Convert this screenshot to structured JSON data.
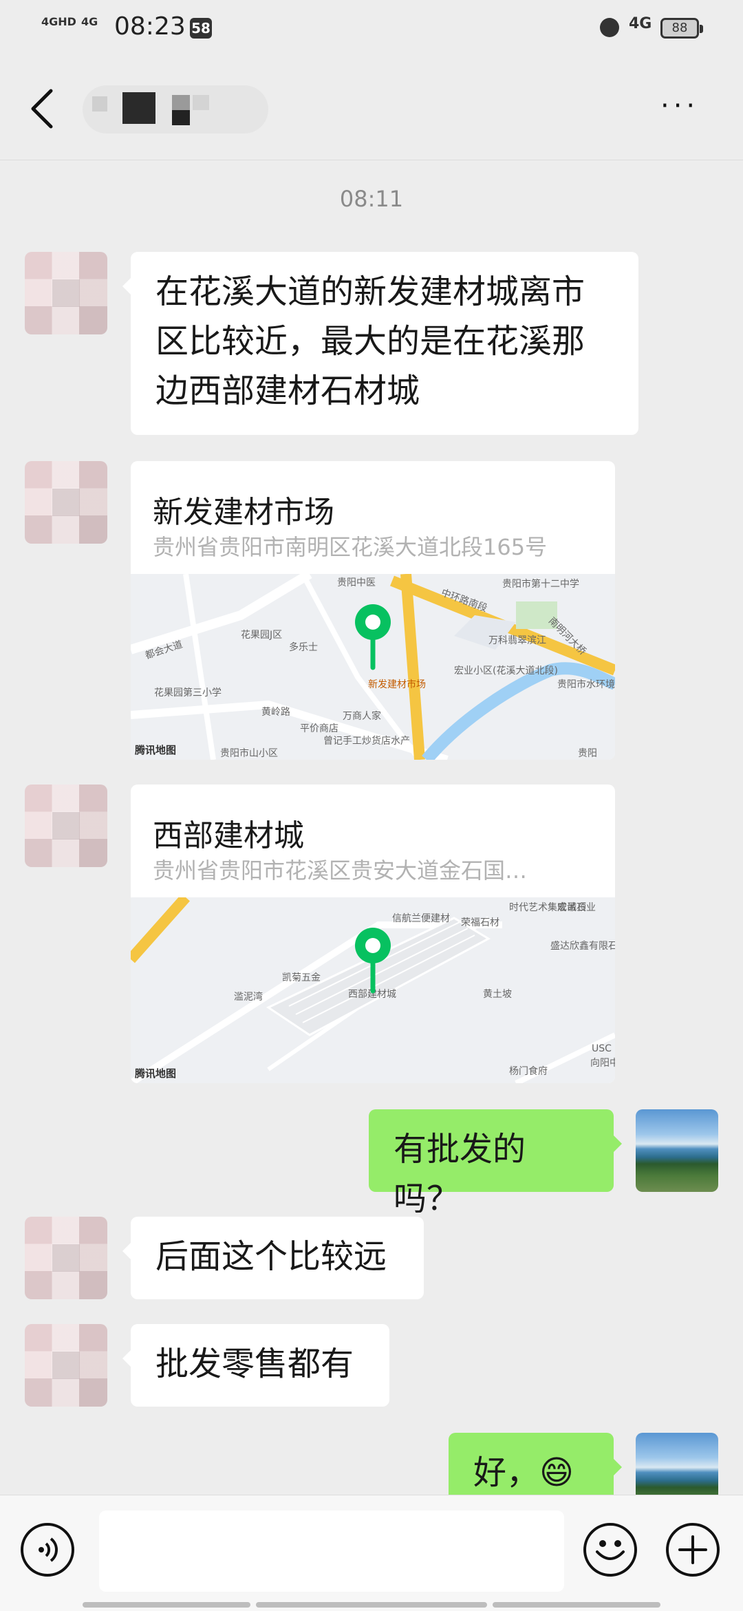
{
  "status_bar": {
    "network1": "4GHD",
    "network2": "4G",
    "time": "08:23",
    "badge": "58",
    "network3": "4G",
    "battery": "88"
  },
  "header": {
    "back_icon": "chevron-left-icon",
    "more_icon": "more-horizontal-icon",
    "more_label": "···"
  },
  "chat": {
    "time_divider": "08:11",
    "messages": [
      {
        "side": "left",
        "type": "text",
        "text": "在花溪大道的新发建材城离市\n区比较近，最大的是在花溪那\n边西部建材石材城"
      },
      {
        "side": "left",
        "type": "location",
        "name": "新发建材市场",
        "address": "贵州省贵阳市南明区花溪大道北段165号",
        "map_labels": [
          "贵阳中医",
          "贵阳市第十二中学",
          "中环路南段",
          "万科翡翠滨江",
          "南明河大桥",
          "花果园J区",
          "多乐士",
          "都会大道",
          "新发建材市场",
          "宏业小区(花溪大道北段)",
          "贵阳市水环境科普馆",
          "花果园第三小学",
          "黄岭路",
          "万商人家",
          "平价商店",
          "曾记手工炒货店水产",
          "贵阳市山小区",
          "贵阳"
        ],
        "map_brand": "腾讯地图"
      },
      {
        "side": "left",
        "type": "location",
        "name": "西部建材城",
        "address": "贵州省贵阳市花溪区贵安大道金石国…",
        "map_labels": [
          "信航兰便建材",
          "时代艺术集成吊顶",
          "宏诚石业",
          "荣福石材",
          "盛达欣鑫有限石业",
          "凯菊五金",
          "西部建材城",
          "滥泥湾",
          "黄土坡",
          "杨门食府",
          "USC",
          "向阳中"
        ],
        "map_brand": "腾讯地图"
      },
      {
        "side": "right",
        "type": "text",
        "text": "有批发的吗？"
      },
      {
        "side": "left",
        "type": "text",
        "text": "后面这个比较远"
      },
      {
        "side": "left",
        "type": "text",
        "text": "批发零售都有"
      },
      {
        "side": "right",
        "type": "text",
        "text": "好，😄"
      }
    ]
  },
  "input_bar": {
    "voice_icon": "voice-icon",
    "emoji_icon": "emoji-icon",
    "plus_icon": "plus-icon",
    "value": ""
  },
  "colors": {
    "background": "#ededed",
    "bubble_self": "#95ec69",
    "bubble_other": "#ffffff",
    "pin": "#07c160"
  }
}
